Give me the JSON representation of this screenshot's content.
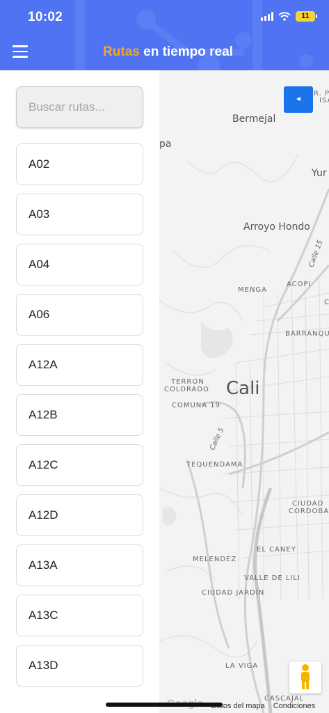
{
  "status_bar": {
    "time": "10:02",
    "battery": "11"
  },
  "header": {
    "title_accent": "Rutas",
    "title_rest": " en tiempo real"
  },
  "search": {
    "placeholder": "Buscar rutas..."
  },
  "routes": [
    {
      "label": "A02"
    },
    {
      "label": "A03"
    },
    {
      "label": "A04"
    },
    {
      "label": "A06"
    },
    {
      "label": "A12A"
    },
    {
      "label": "A12B"
    },
    {
      "label": "A12C"
    },
    {
      "label": "A12D"
    },
    {
      "label": "A13A"
    },
    {
      "label": "A13C"
    },
    {
      "label": "A13D"
    }
  ],
  "map": {
    "labels": {
      "bermejal": "Bermejal",
      "pa": "pa",
      "yur": "Yur",
      "arroyo_hondo": "Arroyo Hondo",
      "calle15": "Calle 15",
      "menga": "MENGA",
      "acopi": "ACOPI",
      "barranqu": "BARRANQU",
      "terron": "TERRON",
      "colorado": "COLORADO",
      "cali": "Cali",
      "comuna19": "COMUNA 19",
      "calle5": "Calle 5",
      "tequendama": "TEQUENDAMA",
      "ciudad": "CIUDAD",
      "cordoba": "CORDOBA",
      "el_caney": "EL CANEY",
      "melendez": "MELENDEZ",
      "valle_de_lili": "VALLE DE LILI",
      "ciudad_jardin": "CIUDAD JARDÍN",
      "la_viga": "LA VIGA",
      "cascajal": "CASCAJAL",
      "corner_top": "R. P",
      "corner_top2": "ISA",
      "corner_c": "C"
    },
    "attribution": {
      "logo": "Google",
      "data": "Datos del mapa",
      "terms": "Condiciones"
    },
    "back_symbol": "◄"
  },
  "colors": {
    "header": "#4f73f3",
    "accent": "#f5a623",
    "map_button": "#1a73e8"
  }
}
